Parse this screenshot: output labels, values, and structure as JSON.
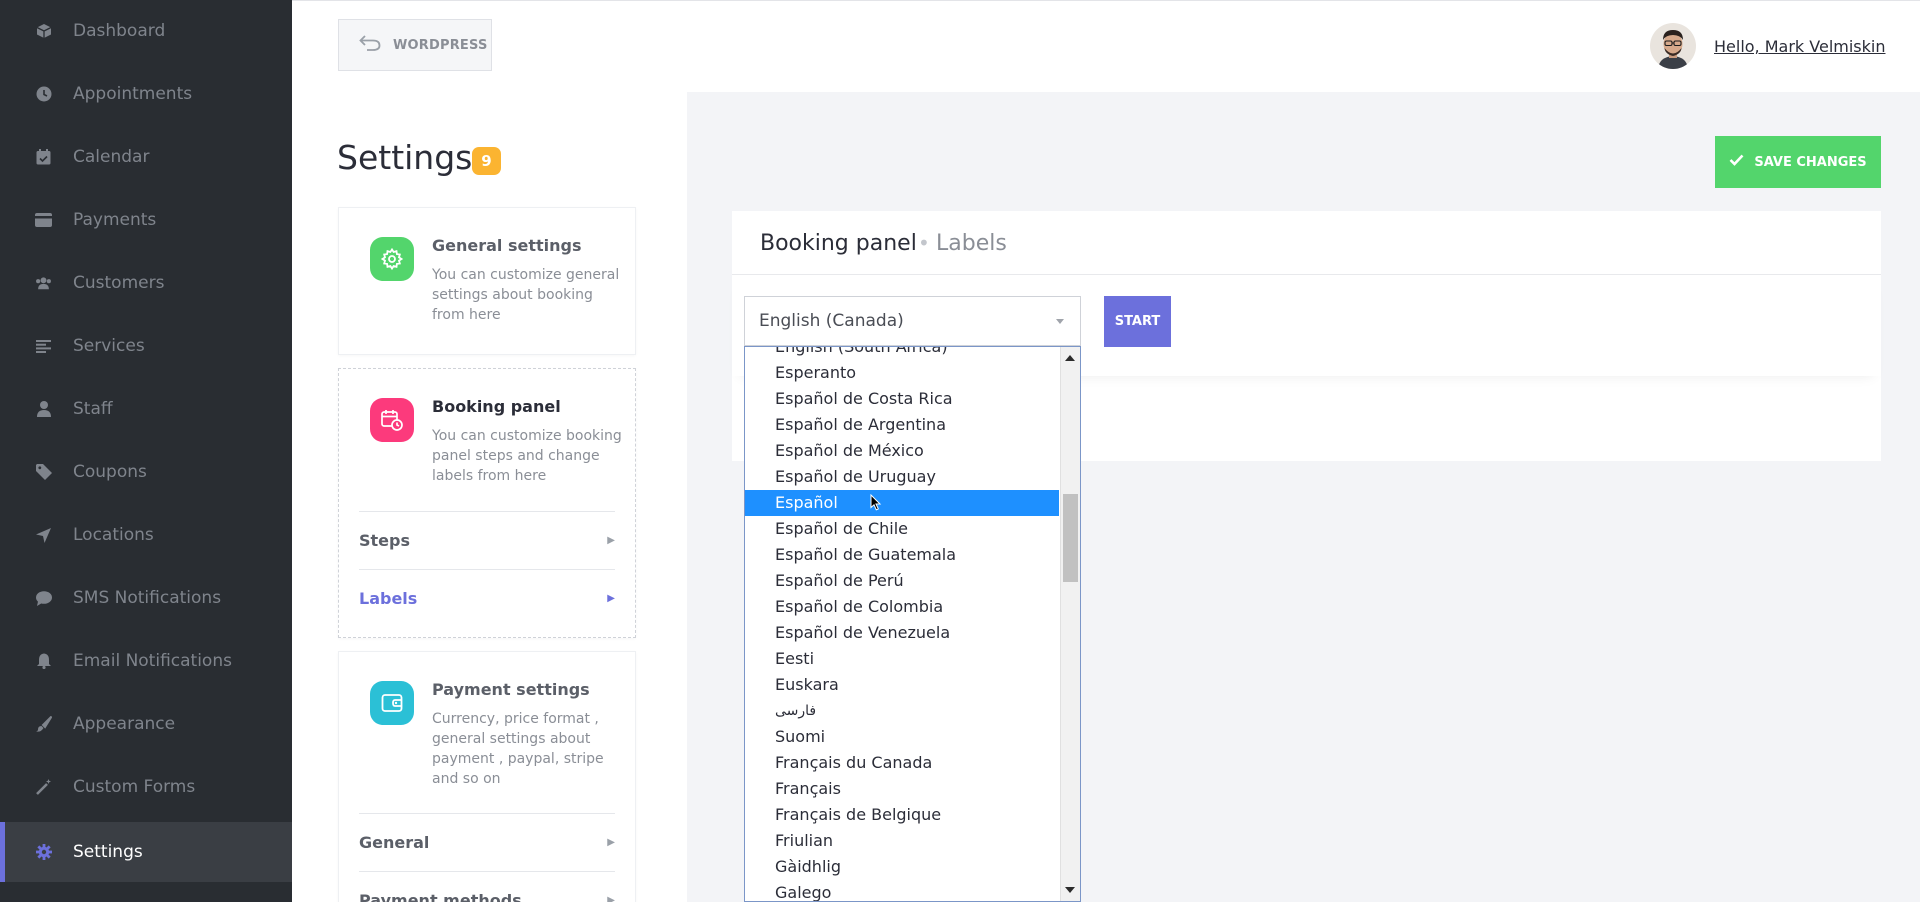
{
  "sidebar": {
    "items": [
      {
        "label": "Dashboard",
        "icon": "cube-icon"
      },
      {
        "label": "Appointments",
        "icon": "clock-icon"
      },
      {
        "label": "Calendar",
        "icon": "calendar-check-icon"
      },
      {
        "label": "Payments",
        "icon": "credit-card-icon"
      },
      {
        "label": "Customers",
        "icon": "users-icon"
      },
      {
        "label": "Services",
        "icon": "list-icon"
      },
      {
        "label": "Staff",
        "icon": "user-icon"
      },
      {
        "label": "Coupons",
        "icon": "tag-icon"
      },
      {
        "label": "Locations",
        "icon": "location-arrow-icon"
      },
      {
        "label": "SMS Notifications",
        "icon": "comment-icon"
      },
      {
        "label": "Email Notifications",
        "icon": "bell-icon"
      },
      {
        "label": "Appearance",
        "icon": "paint-brush-icon"
      },
      {
        "label": "Custom Forms",
        "icon": "magic-wand-icon"
      },
      {
        "label": "Settings",
        "icon": "gear-icon",
        "active": true
      }
    ]
  },
  "header": {
    "wordpress_label": "WORDPRESS",
    "greeting": "Hello, Mark Velmiskin"
  },
  "settings": {
    "title": "Settings",
    "badge": "9",
    "cards": {
      "general": {
        "title": "General settings",
        "desc": "You can customize general settings about booking from here",
        "color": "#53d56c"
      },
      "booking": {
        "title": "Booking panel",
        "desc": "You can customize booking panel steps and change labels from here",
        "color": "#fc3a7c",
        "links": [
          "Steps",
          "Labels"
        ]
      },
      "payment": {
        "title": "Payment settings",
        "desc": "Currency, price format , general settings about payment , paypal, stripe and so on",
        "color": "#2bc0d6",
        "links": [
          "General",
          "Payment methods"
        ]
      }
    }
  },
  "toolbar": {
    "save_label": "SAVE CHANGES"
  },
  "panel": {
    "title": "Booking panel",
    "subtitle": "Labels",
    "language_value": "English (Canada)",
    "start_label": "START"
  },
  "dropdown": {
    "options": [
      "English (South Africa)",
      "Esperanto",
      "Español de Costa Rica",
      "Español de Argentina",
      "Español de México",
      "Español de Uruguay",
      "Español",
      "Español de Chile",
      "Español de Guatemala",
      "Español de Perú",
      "Español de Colombia",
      "Español de Venezuela",
      "Eesti",
      "Euskara",
      "فارسی",
      "Suomi",
      "Français du Canada",
      "Français",
      "Français de Belgique",
      "Friulian",
      "Gàidhlig",
      "Galego"
    ],
    "selected": "Español"
  },
  "colors": {
    "sidebar_bg": "#292d32",
    "accent": "#6c70dc",
    "save": "#53d56c",
    "badge": "#fbb431",
    "selected_option": "#1e90ff"
  }
}
